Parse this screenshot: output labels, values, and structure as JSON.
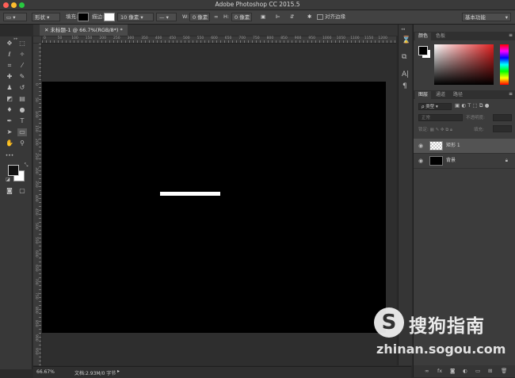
{
  "app": {
    "title": "Adobe Photoshop CC 2015.5"
  },
  "options_bar": {
    "mode_value": "形状",
    "fill_label": "填充:",
    "stroke_label": "描边:",
    "stroke_width_value": "10 像素",
    "w_label": "W:",
    "w_value": "0 像素",
    "h_label": "H:",
    "h_value": "0 像素",
    "align_edges_label": "对齐边缘",
    "workspace_value": "基本功能",
    "colors": {
      "fill": "#000000"
    }
  },
  "document_tab": {
    "label": "未标题-1 @ 66.7%(RGB/8*) *"
  },
  "rulers": {
    "h_ticks": [
      "0",
      "50",
      "100",
      "150",
      "200",
      "250",
      "300",
      "350",
      "400",
      "450",
      "500",
      "550",
      "600",
      "650",
      "700",
      "750",
      "800",
      "850",
      "900",
      "950",
      "1000",
      "1050",
      "1100",
      "1150",
      "1200"
    ],
    "v_ticks": [
      "0",
      "50",
      "100",
      "150",
      "200",
      "250",
      "300",
      "350",
      "400",
      "450",
      "500",
      "550",
      "600",
      "650",
      "700",
      "750",
      "800",
      "850",
      "900",
      "950"
    ]
  },
  "status_bar": {
    "zoom": "66.67%",
    "doc_info": "文档:2.93M/0 字节"
  },
  "color_panel": {
    "tabs": [
      "颜色",
      "色板"
    ],
    "active": 0
  },
  "layers_panel": {
    "tabs": [
      "图层",
      "通道",
      "路径"
    ],
    "active": 0,
    "filter_value": "ρ 类型",
    "blend_value": "正常",
    "opacity_label": "不透明度:",
    "lock_label": "锁定:",
    "fill_label": "填充:",
    "layers": [
      {
        "name": "矩形 1",
        "thumb": "checker"
      },
      {
        "name": "背景",
        "thumb": "black",
        "locked": true
      }
    ]
  },
  "watermark": {
    "logo_letter": "S",
    "brand": "搜狗指南",
    "url": "zhinan.sogou.com"
  }
}
